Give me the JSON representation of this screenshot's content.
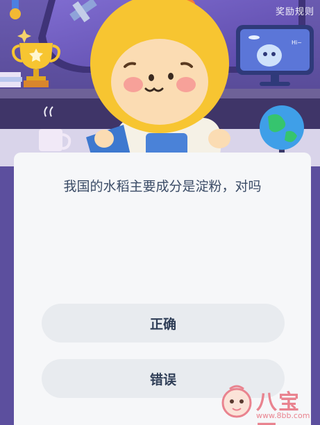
{
  "header": {
    "rules_label": "奖励规则"
  },
  "quiz": {
    "question": "我国的水稻主要成分是淀粉，对吗",
    "options": [
      {
        "label": "正确"
      },
      {
        "label": "错误"
      }
    ]
  },
  "decor": {
    "screen_text": "Hi~",
    "watermark_text": "八宝网",
    "watermark_url": "www.8bb.com"
  },
  "colors": {
    "banner_bg": "#5c4f9e",
    "card_bg": "#f6f7f9",
    "option_bg": "#e8ebef",
    "question_text": "#3a4b66",
    "mascot_yellow": "#f7c531",
    "watermark": "#e9838f"
  },
  "icons": [
    "trophy-icon",
    "globe-icon",
    "tv-alien-icon",
    "mug-icon",
    "satellite-icon",
    "mascot-character"
  ]
}
